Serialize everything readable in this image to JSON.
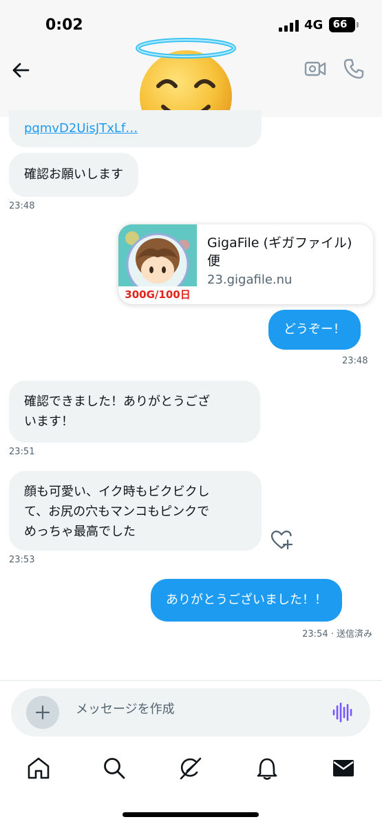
{
  "status_bar": {
    "time": "0:02",
    "network": "4G",
    "battery": "66",
    "battery_level": 0.66
  },
  "header": {
    "back_icon": "arrow-left-icon",
    "video_icon": "video-camera-icon",
    "call_icon": "phone-icon",
    "avatar_icon": "smiling-face-with-halo-emoji"
  },
  "messages": {
    "m1": {
      "text": "pqmvD2UisJTxLf…",
      "direction": "in"
    },
    "m2": {
      "text": "確認お願いします",
      "direction": "in",
      "time": "23:48"
    },
    "link_card": {
      "title": "GigaFile (ギガファイル) 便",
      "domain": "23.gigafile.nu",
      "thumb_caption": "300G/100日"
    },
    "m3": {
      "text": "どうぞー！",
      "direction": "out",
      "time": "23:48"
    },
    "m4": {
      "line1": "確認できました！ありがとうござ",
      "line2": "います！",
      "direction": "in",
      "time": "23:51"
    },
    "m5": {
      "line1": "顔も可愛い、イク時もビクビクし",
      "line2": "て、お尻の穴もマンコもピンクで",
      "line3": "めっちゃ最高でした",
      "direction": "in",
      "time": "23:53"
    },
    "m6": {
      "text": "ありがとうございました！！",
      "direction": "out",
      "time": "23:54 · 送信済み"
    },
    "react_icon": "heart-plus-icon"
  },
  "composer": {
    "placeholder": "メッセージを作成",
    "plus_icon": "plus-icon",
    "voice_icon": "voice-waveform-icon"
  },
  "tabbar": {
    "items": [
      "home-icon",
      "search-icon",
      "grok-icon",
      "bell-icon",
      "mail-icon"
    ],
    "active": "mail-icon"
  },
  "colors": {
    "accent": "#1d9bf0",
    "incoming_bubble": "#eff3f4",
    "voice": "#7856ff"
  }
}
